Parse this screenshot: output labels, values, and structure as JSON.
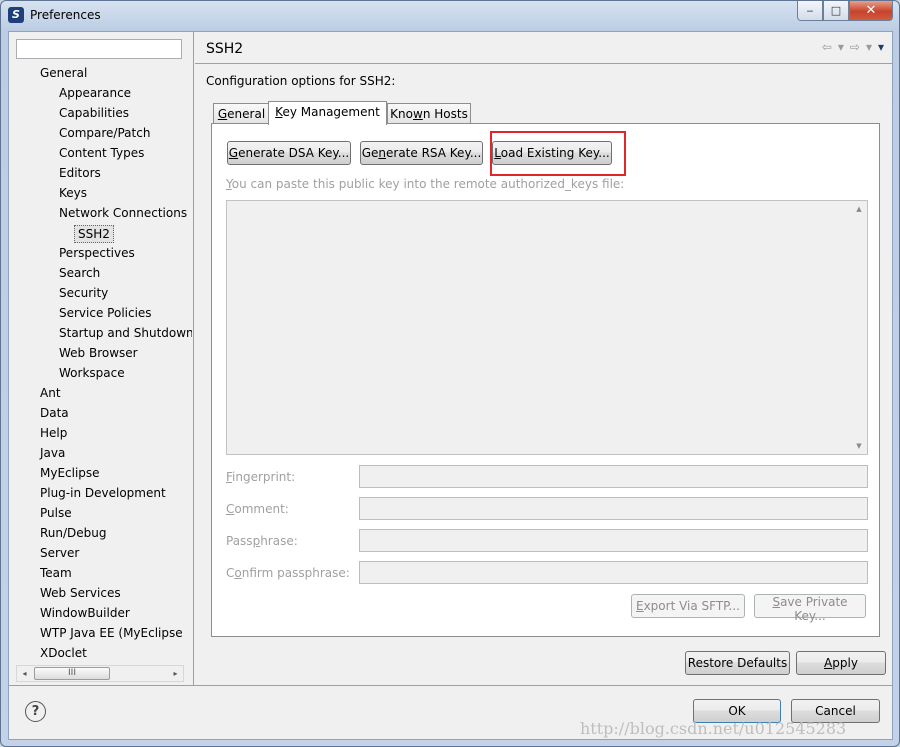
{
  "window": {
    "title": "Preferences",
    "app_icon_letter": "S",
    "controls": {
      "minimize": "‒",
      "maximize": "□",
      "close": "✕"
    }
  },
  "filter": {
    "value": "",
    "placeholder": ""
  },
  "tree": {
    "items": [
      {
        "label": "General",
        "level": 1
      },
      {
        "label": "Appearance",
        "level": 2
      },
      {
        "label": "Capabilities",
        "level": 2
      },
      {
        "label": "Compare/Patch",
        "level": 2
      },
      {
        "label": "Content Types",
        "level": 2
      },
      {
        "label": "Editors",
        "level": 2
      },
      {
        "label": "Keys",
        "level": 2
      },
      {
        "label": "Network Connections",
        "level": 2
      },
      {
        "label": "SSH2",
        "level": 3,
        "selected": true
      },
      {
        "label": "Perspectives",
        "level": 2
      },
      {
        "label": "Search",
        "level": 2
      },
      {
        "label": "Security",
        "level": 2
      },
      {
        "label": "Service Policies",
        "level": 2
      },
      {
        "label": "Startup and Shutdown",
        "level": 2
      },
      {
        "label": "Web Browser",
        "level": 2
      },
      {
        "label": "Workspace",
        "level": 2
      },
      {
        "label": "Ant",
        "level": 1
      },
      {
        "label": "Data",
        "level": 1
      },
      {
        "label": "Help",
        "level": 1
      },
      {
        "label": "Java",
        "level": 1
      },
      {
        "label": "MyEclipse",
        "level": 1
      },
      {
        "label": "Plug-in Development",
        "level": 1
      },
      {
        "label": "Pulse",
        "level": 1
      },
      {
        "label": "Run/Debug",
        "level": 1
      },
      {
        "label": "Server",
        "level": 1
      },
      {
        "label": "Team",
        "level": 1
      },
      {
        "label": "Web Services",
        "level": 1
      },
      {
        "label": "WindowBuilder",
        "level": 1
      },
      {
        "label": "WTP Java EE (MyEclipse",
        "level": 1
      },
      {
        "label": "XDoclet",
        "level": 1
      }
    ],
    "scrollbar": {
      "left_arrow": "◂",
      "right_arrow": "▸",
      "thumb_grip": "III"
    }
  },
  "page": {
    "title": "SSH2",
    "description": "Configuration options for SSH2:",
    "nav": {
      "back": "⇦",
      "back_menu": "▾",
      "forward": "⇨",
      "forward_menu": "▾",
      "view_menu": "▾"
    }
  },
  "tabs": {
    "general": {
      "text": "General",
      "mnemonic": "G",
      "rest": "eneral"
    },
    "key_management": {
      "text": "Key Management",
      "mnemonic": "K",
      "rest": "ey Management"
    },
    "known_hosts": {
      "text": "Known Hosts",
      "prefix": "Kno",
      "mnemonic": "w",
      "rest": "n Hosts"
    }
  },
  "key_management": {
    "generate_dsa": {
      "prefix": "",
      "mnemonic": "G",
      "rest": "enerate DSA Key..."
    },
    "generate_rsa": {
      "prefix": "Ge",
      "mnemonic": "n",
      "rest": "erate RSA Key..."
    },
    "load_existing": {
      "prefix": "",
      "mnemonic": "L",
      "rest": "oad Existing Key..."
    },
    "hint": {
      "mnemonic": "Y",
      "rest": "ou can paste this public key into the remote authorized_keys file:"
    },
    "public_key_value": "",
    "scroll_up": "▲",
    "scroll_down": "▼",
    "fields": {
      "fingerprint": {
        "prefix": "",
        "mnemonic": "F",
        "rest": "ingerprint:",
        "value": ""
      },
      "comment": {
        "prefix": "",
        "mnemonic": "C",
        "rest": "omment:",
        "value": ""
      },
      "passphrase": {
        "prefix": "Pass",
        "mnemonic": "p",
        "rest": "hrase:",
        "value": ""
      },
      "confirm_passphrase": {
        "prefix": "C",
        "mnemonic": "o",
        "rest": "nfirm passphrase:",
        "value": ""
      }
    },
    "export_sftp": {
      "prefix": "",
      "mnemonic": "E",
      "rest": "xport Via SFTP..."
    },
    "save_private": {
      "prefix": "",
      "mnemonic": "S",
      "rest": "ave Private Key..."
    }
  },
  "buttons": {
    "restore_defaults": "Restore Defaults",
    "apply": {
      "mnemonic": "A",
      "rest": "pply"
    },
    "ok": "OK",
    "cancel": "Cancel",
    "help": "?"
  },
  "watermark": "http://blog.csdn.net/u012545283"
}
